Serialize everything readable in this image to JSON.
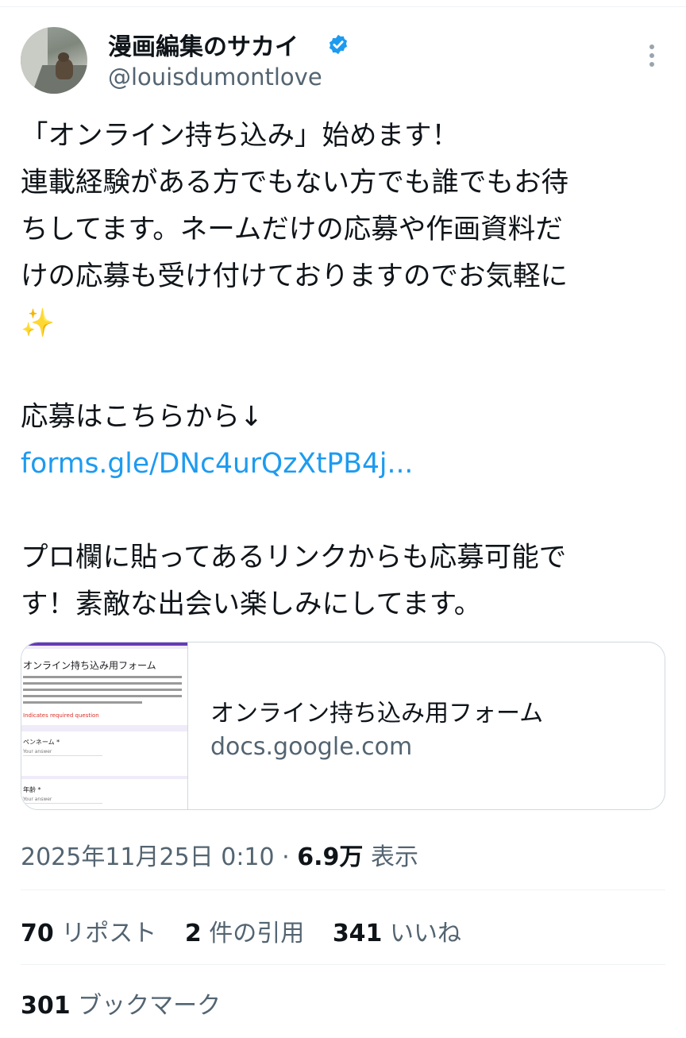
{
  "author": {
    "name": "漫画編集のサカイ",
    "handle": "@louisdumontlove",
    "verified_color": "#1d9bf0"
  },
  "tweet": {
    "lines": [
      "「オンライン持ち込み」始めます！",
      "連載経験がある方でもない方でも誰でもお待",
      "ちしてます。ネームだけの応募や作画資料だ",
      "けの応募も受け付けておりますのでお気軽に",
      "✨",
      "",
      "応募はこちらから↓",
      "",
      "",
      "プロ欄に貼ってあるリンクからも応募可能で",
      "す！素敵な出会い楽しみにしてます。"
    ],
    "link_text": "forms.gle/DNc4urQzXtPB4j..."
  },
  "card": {
    "title": "オンライン持ち込み用フォーム",
    "domain": "docs.google.com",
    "thumb_title": "オンライン持ち込み用フォーム",
    "thumb_required": "Indicates required question",
    "thumb_field1": "ペンネーム *",
    "thumb_field2": "年齢 *",
    "thumb_placeholder": "Your answer"
  },
  "meta": {
    "timestamp": "2025年11月25日 0:10",
    "separator": "·",
    "views_count": "6.9万",
    "views_label": "表示"
  },
  "stats": {
    "reposts_count": "70",
    "reposts_label": "リポスト",
    "quotes_count": "2",
    "quotes_label": "件の引用",
    "likes_count": "341",
    "likes_label": "いいね",
    "bookmarks_count": "301",
    "bookmarks_label": "ブックマーク"
  }
}
